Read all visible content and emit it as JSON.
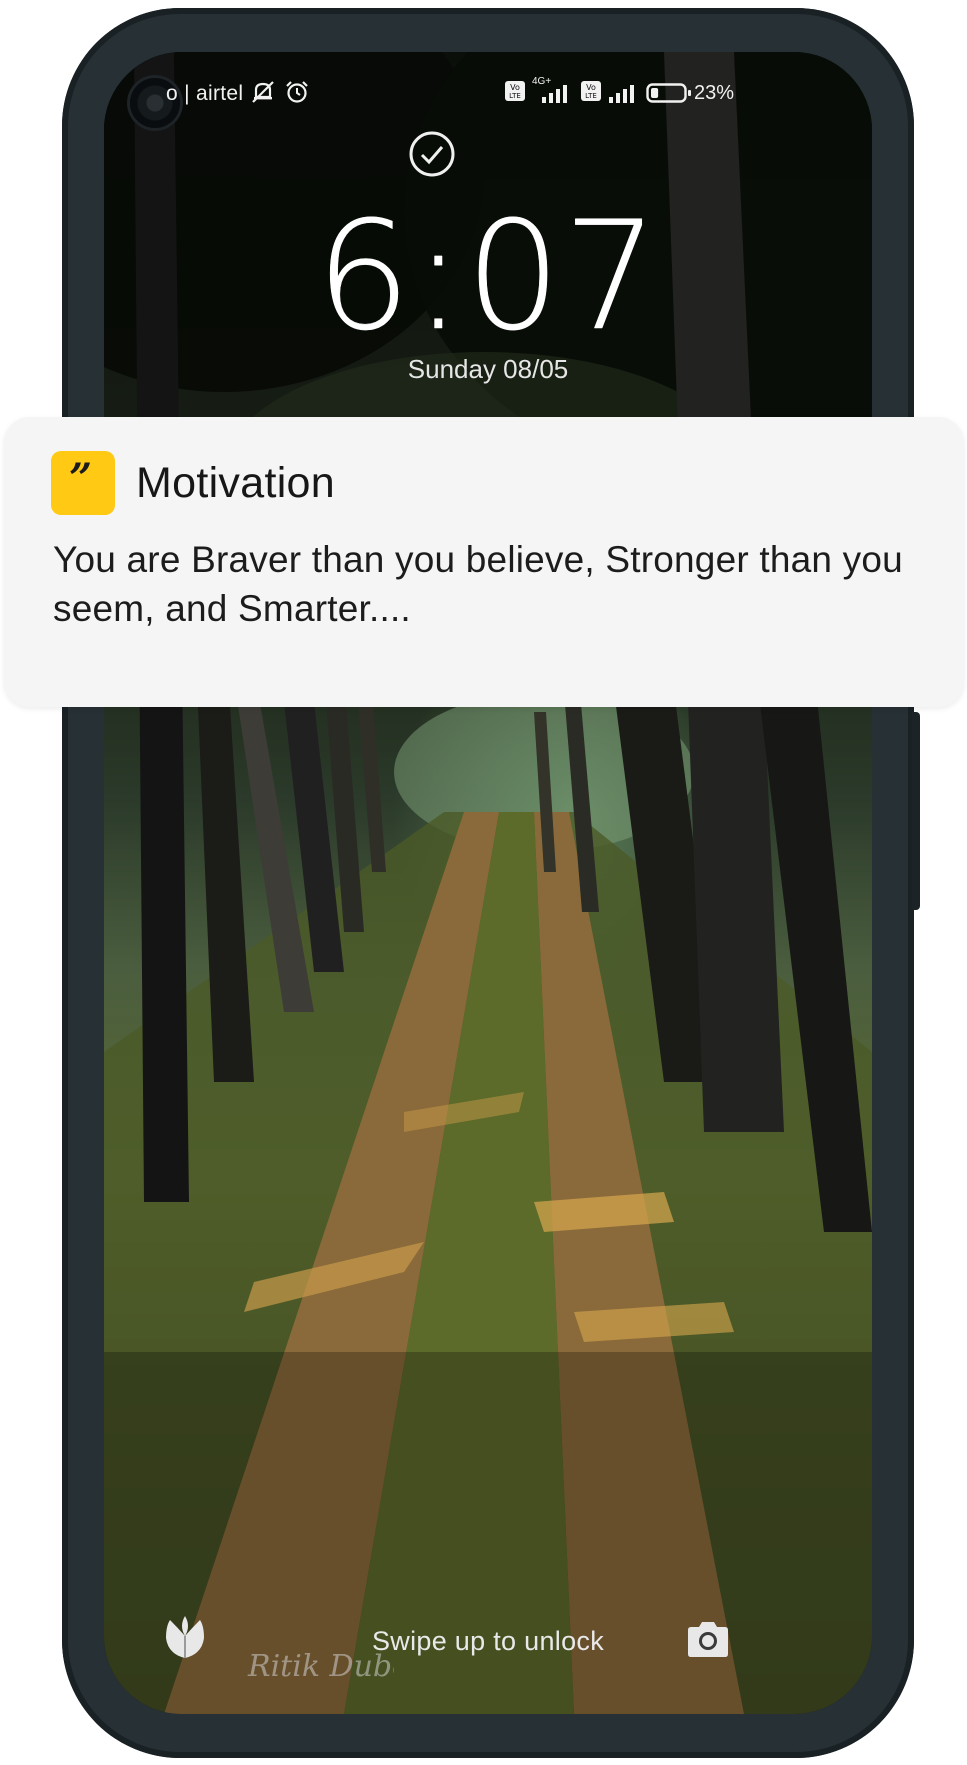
{
  "status_bar": {
    "carrier": "o | airtel",
    "network_badge": "4G+",
    "volte_badge": "Vo LTE",
    "battery_percent": "23%",
    "battery_level": 0.23,
    "icons": [
      "mute-notifications-icon",
      "alarm-icon",
      "signal-icon",
      "battery-icon"
    ]
  },
  "lock_screen": {
    "time": "6:07",
    "date": "Sunday 08/05",
    "check_icon": "check-circle-icon"
  },
  "notification": {
    "app_name": "Motivation",
    "app_icon": "quote-icon",
    "app_icon_glyph": "”",
    "accent_color": "#ffc914",
    "message": "You are Braver than you believe, Stronger than you seem, and Smarter...."
  },
  "bottom_bar": {
    "unlock_hint": "Swipe up to unlock",
    "left_shortcut_icon": "tulip-icon",
    "right_shortcut_icon": "camera-icon",
    "watermark": "Ritik Dube"
  }
}
